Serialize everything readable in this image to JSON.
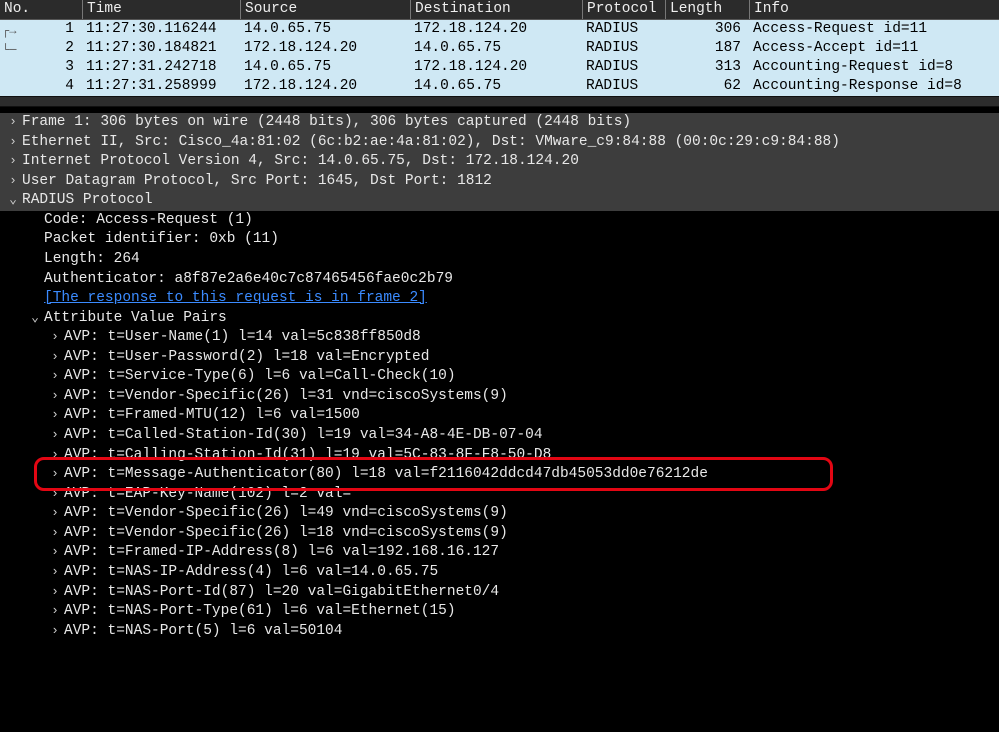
{
  "columns": {
    "no": "No.",
    "time": "Time",
    "src": "Source",
    "dst": "Destination",
    "prot": "Protocol",
    "len": "Length",
    "info": "Info"
  },
  "packets": [
    {
      "no": "1",
      "time": "11:27:30.116244",
      "src": "14.0.65.75",
      "dst": "172.18.124.20",
      "prot": "RADIUS",
      "len": "306",
      "info": "Access-Request id=11"
    },
    {
      "no": "2",
      "time": "11:27:30.184821",
      "src": "172.18.124.20",
      "dst": "14.0.65.75",
      "prot": "RADIUS",
      "len": "187",
      "info": "Access-Accept id=11"
    },
    {
      "no": "3",
      "time": "11:27:31.242718",
      "src": "14.0.65.75",
      "dst": "172.18.124.20",
      "prot": "RADIUS",
      "len": "313",
      "info": "Accounting-Request id=8"
    },
    {
      "no": "4",
      "time": "11:27:31.258999",
      "src": "172.18.124.20",
      "dst": "14.0.65.75",
      "prot": "RADIUS",
      "len": "62",
      "info": "Accounting-Response id=8"
    }
  ],
  "tree": {
    "frame": "Frame 1: 306 bytes on wire (2448 bits), 306 bytes captured (2448 bits)",
    "eth": "Ethernet II, Src: Cisco_4a:81:02 (6c:b2:ae:4a:81:02), Dst: VMware_c9:84:88 (00:0c:29:c9:84:88)",
    "ip": "Internet Protocol Version 4, Src: 14.0.65.75, Dst: 172.18.124.20",
    "udp": "User Datagram Protocol, Src Port: 1645, Dst Port: 1812",
    "radius": "RADIUS Protocol",
    "code": "Code: Access-Request (1)",
    "pktid": "Packet identifier: 0xb (11)",
    "length": "Length: 264",
    "auth": "Authenticator: a8f87e2a6e40c7c87465456fae0c2b79",
    "resplink": "[The response to this request is in frame 2]",
    "avpheader": "Attribute Value Pairs",
    "avps": [
      "AVP: t=User-Name(1) l=14 val=5c838ff850d8",
      "AVP: t=User-Password(2) l=18 val=Encrypted",
      "AVP: t=Service-Type(6) l=6 val=Call-Check(10)",
      "AVP: t=Vendor-Specific(26) l=31 vnd=ciscoSystems(9)",
      "AVP: t=Framed-MTU(12) l=6 val=1500",
      "AVP: t=Called-Station-Id(30) l=19 val=34-A8-4E-DB-07-04",
      "AVP: t=Calling-Station-Id(31) l=19 val=5C-83-8F-F8-50-D8",
      "AVP: t=Message-Authenticator(80) l=18 val=f2116042ddcd47db45053dd0e76212de",
      "AVP: t=EAP-Key-Name(102) l=2 val=",
      "AVP: t=Vendor-Specific(26) l=49 vnd=ciscoSystems(9)",
      "AVP: t=Vendor-Specific(26) l=18 vnd=ciscoSystems(9)",
      "AVP: t=Framed-IP-Address(8) l=6 val=192.168.16.127",
      "AVP: t=NAS-IP-Address(4) l=6 val=14.0.65.75",
      "AVP: t=NAS-Port-Id(87) l=20 val=GigabitEthernet0/4",
      "AVP: t=NAS-Port-Type(61) l=6 val=Ethernet(15)",
      "AVP: t=NAS-Port(5) l=6 val=50104"
    ]
  },
  "highlight_index": 7
}
